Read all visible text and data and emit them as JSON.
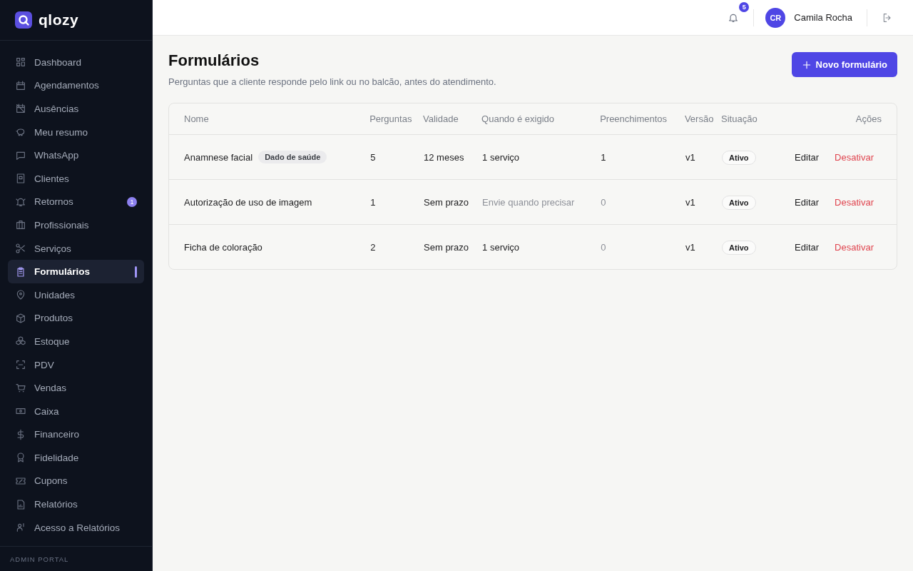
{
  "sidebar": {
    "logo": "qlozy",
    "items": [
      {
        "label": "Dashboard",
        "selected": false
      },
      {
        "label": "Agendamentos",
        "selected": false
      },
      {
        "label": "Ausências",
        "selected": false
      },
      {
        "label": "Meu resumo",
        "selected": false
      },
      {
        "label": "WhatsApp",
        "selected": false
      },
      {
        "label": "Clientes",
        "selected": false
      },
      {
        "label": "Retornos",
        "selected": false,
        "badge": "1"
      },
      {
        "label": "Profissionais",
        "selected": false
      },
      {
        "label": "Serviços",
        "selected": false
      },
      {
        "label": "Formulários",
        "selected": true
      },
      {
        "label": "Unidades",
        "selected": false
      },
      {
        "label": "Produtos",
        "selected": false
      },
      {
        "label": "Estoque",
        "selected": false
      },
      {
        "label": "PDV",
        "selected": false
      },
      {
        "label": "Vendas",
        "selected": false
      },
      {
        "label": "Caixa",
        "selected": false
      },
      {
        "label": "Financeiro",
        "selected": false
      },
      {
        "label": "Fidelidade",
        "selected": false
      },
      {
        "label": "Cupons",
        "selected": false
      },
      {
        "label": "Relatórios",
        "selected": false
      },
      {
        "label": "Acesso a Relatórios",
        "selected": false
      }
    ],
    "footer": "ADMIN PORTAL"
  },
  "header": {
    "notifications": "5",
    "avatar": "CR",
    "user": "Camila Rocha"
  },
  "page": {
    "title": "Formulários",
    "subtitle": "Perguntas que a cliente responde pelo link ou no balcão, antes do atendimento.",
    "new_button": "Novo formulário"
  },
  "table": {
    "columns": [
      "Nome",
      "Perguntas",
      "Validade",
      "Quando é exigido",
      "Preenchimentos",
      "Versão",
      "Situação",
      "Ações"
    ],
    "rows": [
      {
        "cells": [
          {
            "kind": "name",
            "text": "Anamnese facial",
            "tag": "Dado de saúde"
          },
          {
            "kind": "value",
            "text": "5",
            "muted": false
          },
          {
            "kind": "value",
            "text": "12 meses",
            "muted": false
          },
          {
            "kind": "value",
            "text": "1 serviço",
            "muted": false
          },
          {
            "kind": "value",
            "text": "1",
            "muted": false
          },
          {
            "kind": "value",
            "text": "v1",
            "muted": false
          },
          {
            "kind": "status",
            "text": "Ativo"
          }
        ],
        "actions": [
          "Editar",
          "Desativar"
        ]
      },
      {
        "cells": [
          {
            "kind": "name",
            "text": "Autorização de uso de imagem"
          },
          {
            "kind": "value",
            "text": "1",
            "muted": false
          },
          {
            "kind": "value",
            "text": "Sem prazo",
            "muted": false
          },
          {
            "kind": "value",
            "text": "Envie quando precisar",
            "muted": true
          },
          {
            "kind": "value",
            "text": "0",
            "muted": true
          },
          {
            "kind": "value",
            "text": "v1",
            "muted": false
          },
          {
            "kind": "status",
            "text": "Ativo"
          }
        ],
        "actions": [
          "Editar",
          "Desativar"
        ]
      },
      {
        "cells": [
          {
            "kind": "name",
            "text": "Ficha de coloração"
          },
          {
            "kind": "value",
            "text": "2",
            "muted": false
          },
          {
            "kind": "value",
            "text": "Sem prazo",
            "muted": false
          },
          {
            "kind": "value",
            "text": "1 serviço",
            "muted": false
          },
          {
            "kind": "value",
            "text": "0",
            "muted": true
          },
          {
            "kind": "value",
            "text": "v1",
            "muted": false
          },
          {
            "kind": "status",
            "text": "Ativo"
          }
        ],
        "actions": [
          "Editar",
          "Desativar"
        ]
      }
    ]
  }
}
